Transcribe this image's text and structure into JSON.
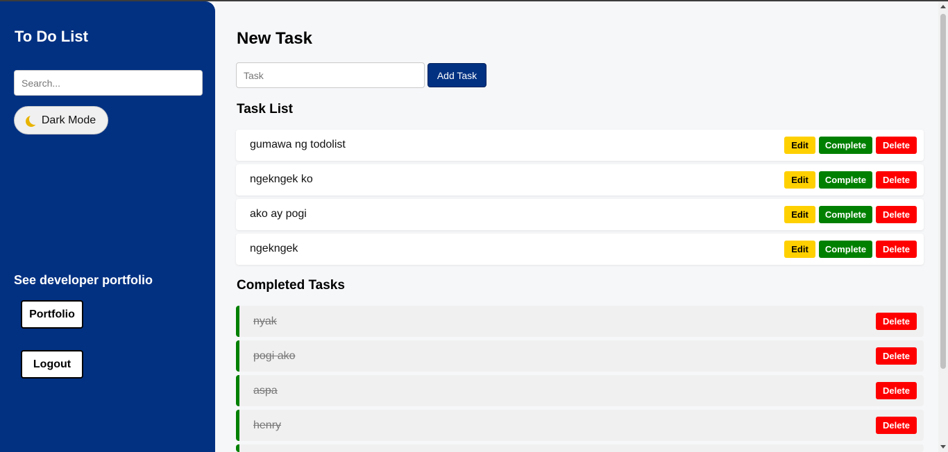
{
  "sidebar": {
    "title": "To Do List",
    "search_placeholder": "Search...",
    "dark_mode_label": "Dark Mode",
    "portfolio_heading": "See developer portfolio",
    "portfolio_button": "Portfolio",
    "logout_button": "Logout"
  },
  "main": {
    "new_task_heading": "New Task",
    "task_placeholder": "Task",
    "add_button": "Add Task",
    "task_list_heading": "Task List",
    "completed_heading": "Completed Tasks",
    "edit_label": "Edit",
    "complete_label": "Complete",
    "delete_label": "Delete",
    "tasks": [
      "gumawa ng todolist",
      "ngekngek ko",
      "ako ay pogi",
      "ngekngek"
    ],
    "completed": [
      "nyak",
      "pogi ako",
      "aspa",
      "henry"
    ]
  },
  "colors": {
    "sidebar_bg": "#023182",
    "edit": "#ffd000",
    "complete": "#008000",
    "delete": "#ff0000"
  },
  "icons": {
    "dark_mode": "moon-icon"
  }
}
